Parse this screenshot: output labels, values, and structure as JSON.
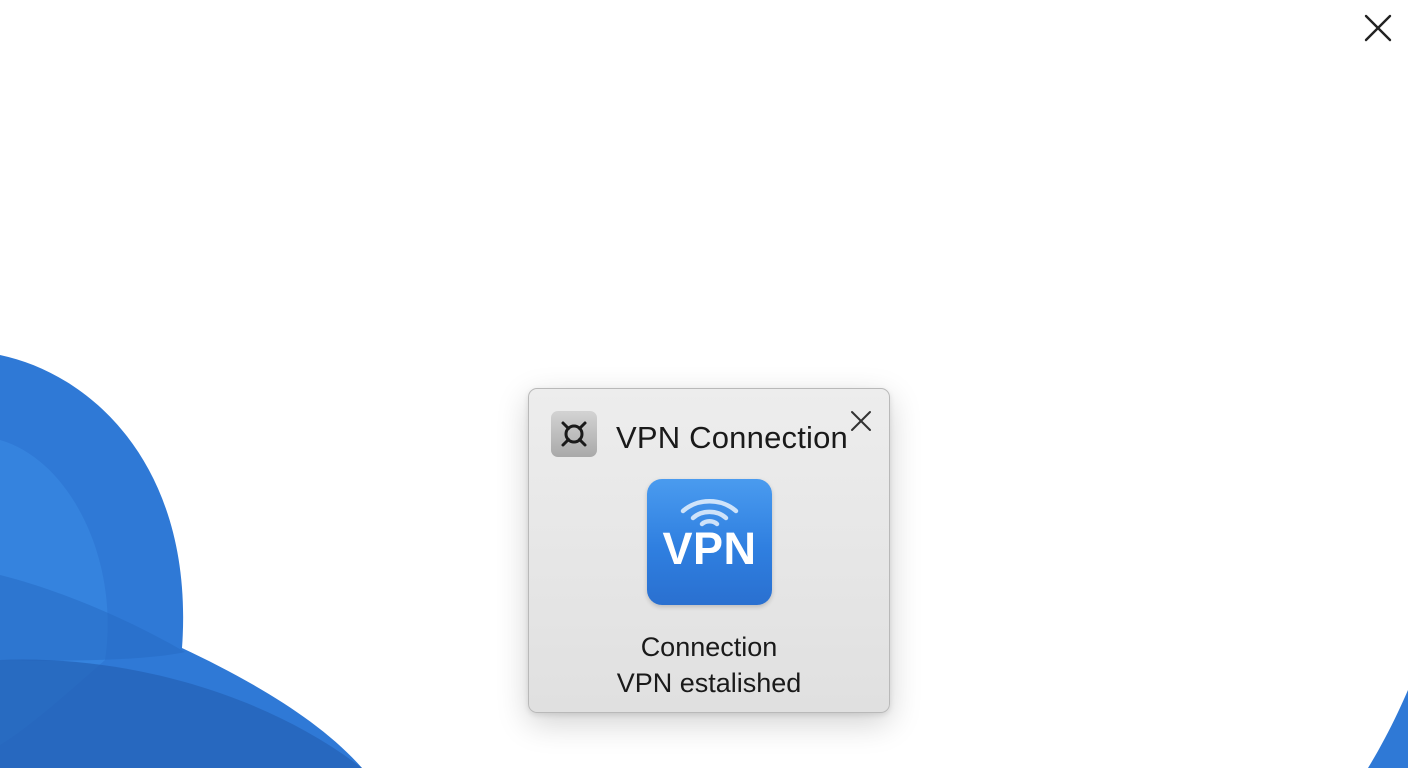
{
  "dialog": {
    "title": "VPN Connection",
    "app_icon": "vpn-lifebuoy-icon",
    "badge": {
      "text": "VPN",
      "icon": "wifi-waves-icon",
      "color": "#3589e8"
    },
    "status_line_1": "Connection",
    "status_line_2": "VPN estalished",
    "close_icon": "close-icon"
  },
  "desktop": {
    "close_icon": "close-icon",
    "wallpaper_accent": "#2f7fe0"
  }
}
